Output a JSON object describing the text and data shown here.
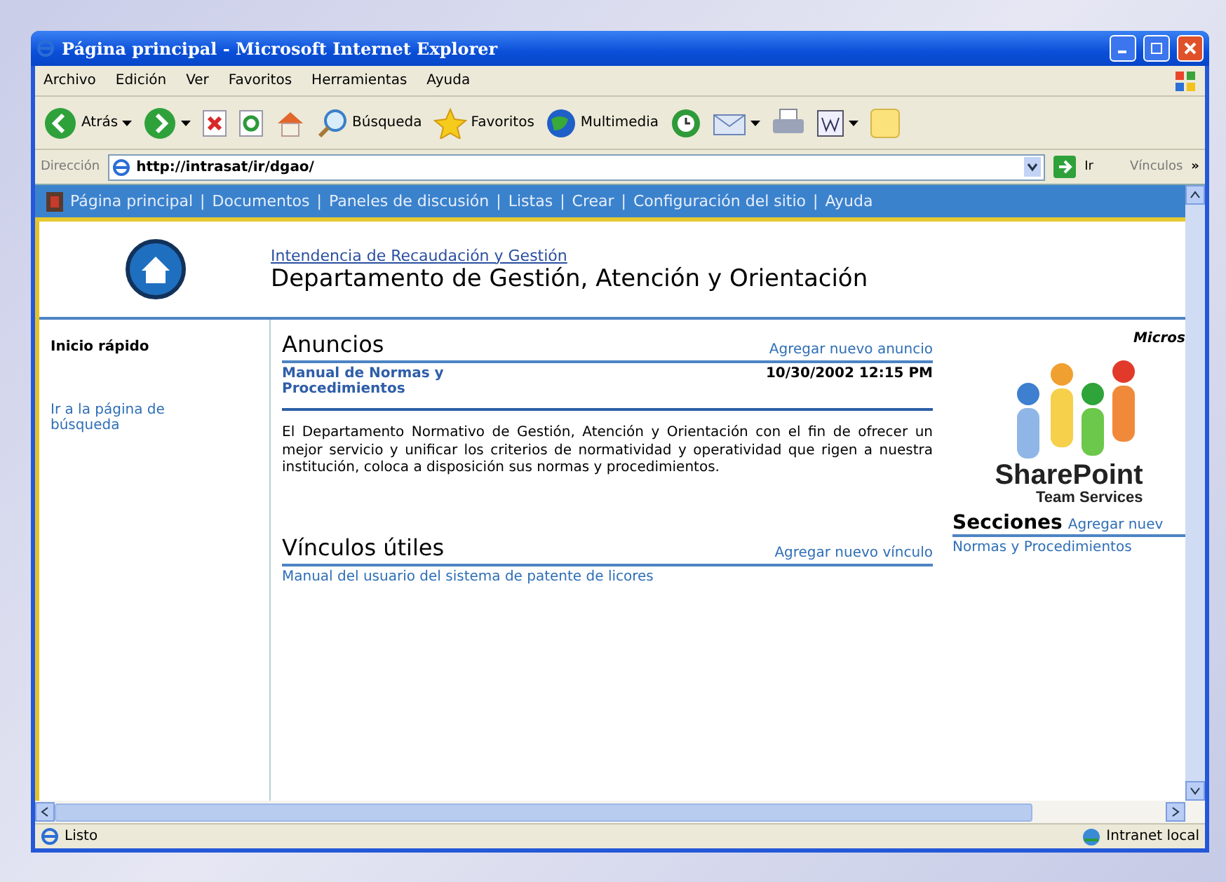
{
  "window": {
    "title": "Página principal - Microsoft Internet Explorer"
  },
  "menu": [
    "Archivo",
    "Edición",
    "Ver",
    "Favoritos",
    "Herramientas",
    "Ayuda"
  ],
  "toolbar": [
    {
      "kind": "back",
      "label": "Atrás",
      "dropdown": true
    },
    {
      "kind": "forward",
      "dropdown": true
    },
    {
      "kind": "stop"
    },
    {
      "kind": "refresh"
    },
    {
      "kind": "home"
    },
    {
      "kind": "search",
      "label": "Búsqueda"
    },
    {
      "kind": "favorites",
      "label": "Favoritos"
    },
    {
      "kind": "media",
      "label": "Multimedia"
    },
    {
      "kind": "history"
    },
    {
      "kind": "mail",
      "dropdown": true
    },
    {
      "kind": "print"
    },
    {
      "kind": "edit",
      "dropdown": true
    },
    {
      "kind": "discuss"
    }
  ],
  "address": {
    "label": "Dirección",
    "value": "http://intrasat/ir/dgao/",
    "go": "Ir",
    "links": "Vínculos",
    "more": "»"
  },
  "site_nav": {
    "separator": "|",
    "links": [
      "Página principal",
      "Documentos",
      "Paneles de discusión",
      "Listas",
      "Crear",
      "Configuración del sitio",
      "Ayuda"
    ]
  },
  "header": {
    "parent_link": "Intendencia de Recaudación y Gestión",
    "title": "Departamento de Gestión, Atención y Orientación"
  },
  "sidebar": {
    "heading": "Inicio rápido",
    "links": [
      "Ir a la página de búsqueda"
    ]
  },
  "announcements": {
    "title": "Anuncios",
    "add": "Agregar nuevo anuncio",
    "items": [
      {
        "title": "Manual de Normas y Procedimientos",
        "date": "10/30/2002 12:15 PM",
        "body": "El Departamento Normativo de Gestión, Atención y Orientación con el fin de ofrecer un mejor servicio y unificar los criterios de normatividad y operatividad que rigen a nuestra institución, coloca a disposición sus normas y procedimientos."
      }
    ]
  },
  "links_section": {
    "title": "Vínculos útiles",
    "add": "Agregar nuevo vínculo",
    "items": [
      "Manual del usuario del sistema de patente de licores"
    ]
  },
  "right": {
    "brand_top": "Micros",
    "logo_title": "SharePoint",
    "logo_subtitle": "Team Services",
    "sections_title": "Secciones",
    "sections_add": "Agregar nuev",
    "sections": [
      "Normas y Procedimientos"
    ]
  },
  "status_bar": {
    "text": "Listo",
    "zone": "Intranet local"
  }
}
